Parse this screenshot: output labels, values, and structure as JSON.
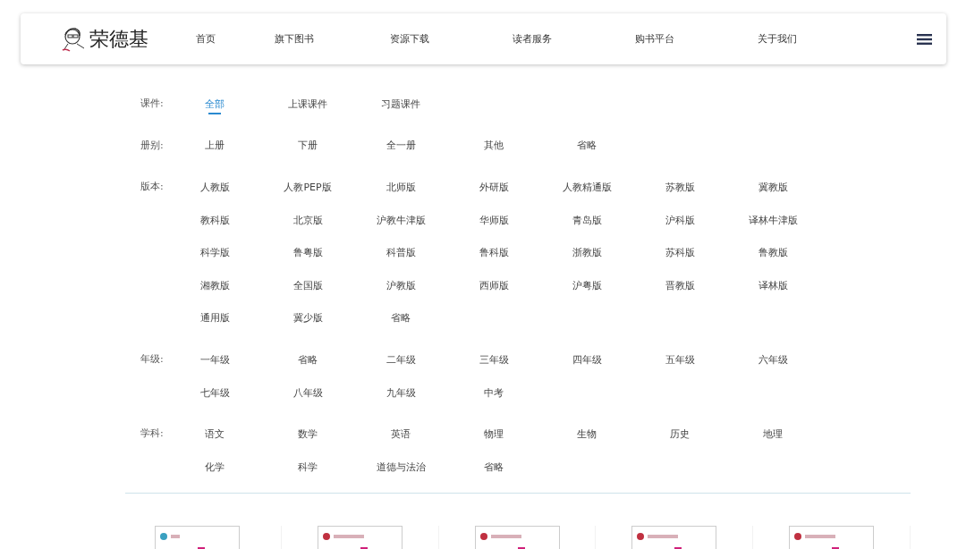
{
  "header": {
    "logo_text": "荣德基",
    "nav": [
      {
        "label": "首页"
      },
      {
        "label": "旗下图书"
      },
      {
        "label": "资源下载"
      },
      {
        "label": "读者服务"
      },
      {
        "label": "购书平台"
      },
      {
        "label": "关于我们"
      }
    ]
  },
  "filters": [
    {
      "label": "课件:",
      "items": [
        {
          "label": "全部",
          "selected": true
        },
        {
          "label": "上课课件",
          "selected": false
        },
        {
          "label": "习题课件",
          "selected": false
        }
      ]
    },
    {
      "label": "册别:",
      "items": [
        {
          "label": "上册",
          "selected": false
        },
        {
          "label": "下册",
          "selected": false
        },
        {
          "label": "全一册",
          "selected": false
        },
        {
          "label": "其他",
          "selected": false
        },
        {
          "label": "省略",
          "selected": false
        }
      ]
    },
    {
      "label": "版本:",
      "items": [
        {
          "label": "人教版",
          "selected": false
        },
        {
          "label": "人教PEP版",
          "selected": false
        },
        {
          "label": "北师版",
          "selected": false
        },
        {
          "label": "外研版",
          "selected": false
        },
        {
          "label": "人教精通版",
          "selected": false
        },
        {
          "label": "苏教版",
          "selected": false
        },
        {
          "label": "冀教版",
          "selected": false
        },
        {
          "label": "教科版",
          "selected": false
        },
        {
          "label": "北京版",
          "selected": false
        },
        {
          "label": "沪教牛津版",
          "selected": false
        },
        {
          "label": "华师版",
          "selected": false
        },
        {
          "label": "青岛版",
          "selected": false
        },
        {
          "label": "沪科版",
          "selected": false
        },
        {
          "label": "译林牛津版",
          "selected": false
        },
        {
          "label": "科学版",
          "selected": false
        },
        {
          "label": "鲁粤版",
          "selected": false
        },
        {
          "label": "科普版",
          "selected": false
        },
        {
          "label": "鲁科版",
          "selected": false
        },
        {
          "label": "浙教版",
          "selected": false
        },
        {
          "label": "苏科版",
          "selected": false
        },
        {
          "label": "鲁教版",
          "selected": false
        },
        {
          "label": "湘教版",
          "selected": false
        },
        {
          "label": "全国版",
          "selected": false
        },
        {
          "label": "沪教版",
          "selected": false
        },
        {
          "label": "西师版",
          "selected": false
        },
        {
          "label": "沪粤版",
          "selected": false
        },
        {
          "label": "晋教版",
          "selected": false
        },
        {
          "label": "译林版",
          "selected": false
        },
        {
          "label": "通用版",
          "selected": false
        },
        {
          "label": "冀少版",
          "selected": false
        },
        {
          "label": "省略",
          "selected": false
        }
      ]
    },
    {
      "label": "年级:",
      "items": [
        {
          "label": "一年级",
          "selected": false
        },
        {
          "label": "省略",
          "selected": false
        },
        {
          "label": "二年级",
          "selected": false
        },
        {
          "label": "三年级",
          "selected": false
        },
        {
          "label": "四年级",
          "selected": false
        },
        {
          "label": "五年级",
          "selected": false
        },
        {
          "label": "六年级",
          "selected": false
        },
        {
          "label": "七年级",
          "selected": false
        },
        {
          "label": "八年级",
          "selected": false
        },
        {
          "label": "九年级",
          "selected": false
        },
        {
          "label": "中考",
          "selected": false
        }
      ]
    },
    {
      "label": "学科:",
      "items": [
        {
          "label": "语文",
          "selected": false
        },
        {
          "label": "数学",
          "selected": false
        },
        {
          "label": "英语",
          "selected": false
        },
        {
          "label": "物理",
          "selected": false
        },
        {
          "label": "生物",
          "selected": false
        },
        {
          "label": "历史",
          "selected": false
        },
        {
          "label": "地理",
          "selected": false
        },
        {
          "label": "化学",
          "selected": false
        },
        {
          "label": "科学",
          "selected": false
        },
        {
          "label": "道德与法治",
          "selected": false
        },
        {
          "label": "省略",
          "selected": false
        }
      ]
    }
  ]
}
